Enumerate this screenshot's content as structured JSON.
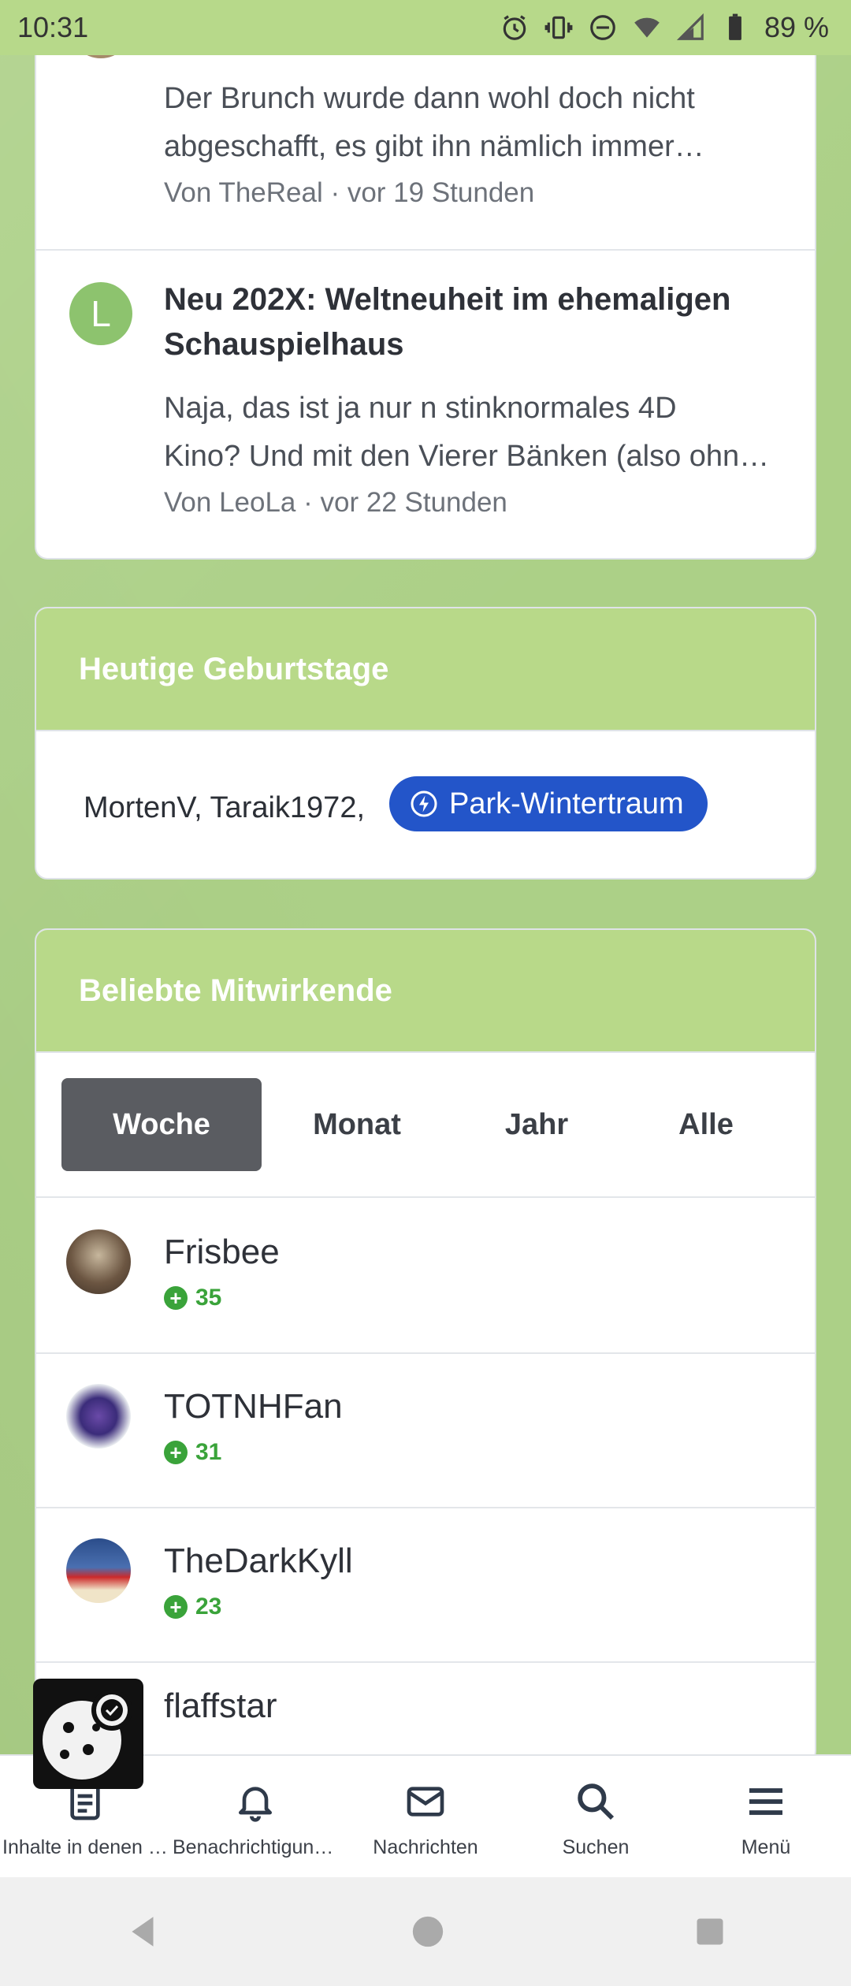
{
  "status_bar": {
    "time": "10:31",
    "battery": "89 %"
  },
  "activity": {
    "items": [
      {
        "text": "Der Brunch wurde dann wohl doch nicht abgeschafft, es gibt ihn nämlich immer…",
        "line1": "Der Brunch wurde dann wohl doch nicht",
        "line2": "abgeschafft, es gibt ihn nämlich immer…",
        "meta": "Von TheReal · vor 19 Stunden"
      },
      {
        "avatar_letter": "L",
        "title_line1": "Neu 202X: Weltneuheit im ehemaligen",
        "title_line2": "Schauspielhaus",
        "line1": "Naja, das ist ja nur n stinknormales 4D",
        "line2": "Kino? Und mit den Vierer Bänken (also ohn…",
        "meta": "Von LeoLa · vor 22 Stunden"
      }
    ]
  },
  "birthdays": {
    "title": "Heutige Geburtstage",
    "names": "MortenV, Taraik1972,",
    "badge": "Park-Wintertraum"
  },
  "contributors": {
    "title": "Beliebte Mitwirkende",
    "tabs": [
      "Woche",
      "Monat",
      "Jahr",
      "Alle"
    ],
    "active_tab": "Woche",
    "list": [
      {
        "name": "Frisbee",
        "score": "35"
      },
      {
        "name": "TOTNHFan",
        "score": "31"
      },
      {
        "name": "TheDarkKyll",
        "score": "23"
      },
      {
        "name": "flaffstar",
        "score": ""
      }
    ]
  },
  "bottom_nav": {
    "items": [
      {
        "label": "Inhalte in denen i…",
        "icon": "document-icon"
      },
      {
        "label": "Benachrichtigung…",
        "icon": "bell-icon"
      },
      {
        "label": "Nachrichten",
        "icon": "envelope-icon"
      },
      {
        "label": "Suchen",
        "icon": "search-icon"
      },
      {
        "label": "Menü",
        "icon": "hamburger-icon"
      }
    ]
  },
  "colors": {
    "accent_green": "#b8d989",
    "badge_blue": "#2355c9",
    "score_green": "#3aa33a"
  }
}
